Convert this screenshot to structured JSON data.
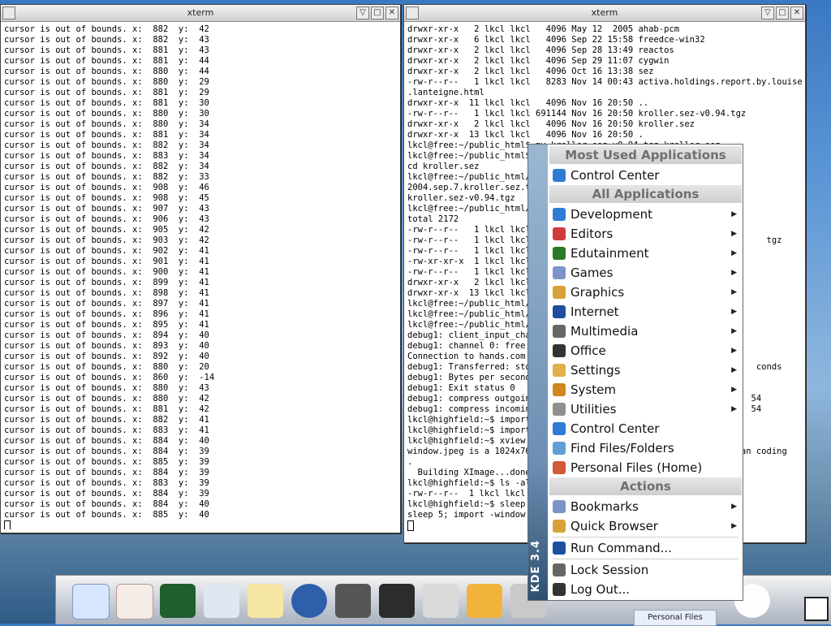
{
  "left_window": {
    "title": "xterm",
    "lines": [
      "cursor is out of bounds. x:  882  y:  42",
      "cursor is out of bounds. x:  882  y:  43",
      "cursor is out of bounds. x:  881  y:  43",
      "cursor is out of bounds. x:  881  y:  44",
      "cursor is out of bounds. x:  880  y:  44",
      "cursor is out of bounds. x:  880  y:  29",
      "cursor is out of bounds. x:  881  y:  29",
      "cursor is out of bounds. x:  881  y:  30",
      "cursor is out of bounds. x:  880  y:  30",
      "cursor is out of bounds. x:  880  y:  34",
      "cursor is out of bounds. x:  881  y:  34",
      "cursor is out of bounds. x:  882  y:  34",
      "cursor is out of bounds. x:  883  y:  34",
      "cursor is out of bounds. x:  882  y:  34",
      "cursor is out of bounds. x:  882  y:  33",
      "cursor is out of bounds. x:  908  y:  46",
      "cursor is out of bounds. x:  908  y:  45",
      "cursor is out of bounds. x:  907  y:  43",
      "cursor is out of bounds. x:  906  y:  43",
      "cursor is out of bounds. x:  905  y:  42",
      "cursor is out of bounds. x:  903  y:  42",
      "cursor is out of bounds. x:  902  y:  41",
      "cursor is out of bounds. x:  901  y:  41",
      "cursor is out of bounds. x:  900  y:  41",
      "cursor is out of bounds. x:  899  y:  41",
      "cursor is out of bounds. x:  898  y:  41",
      "cursor is out of bounds. x:  897  y:  41",
      "cursor is out of bounds. x:  896  y:  41",
      "cursor is out of bounds. x:  895  y:  41",
      "cursor is out of bounds. x:  894  y:  40",
      "cursor is out of bounds. x:  893  y:  40",
      "cursor is out of bounds. x:  892  y:  40",
      "cursor is out of bounds. x:  880  y:  20",
      "cursor is out of bounds. x:  860  y:  -14",
      "cursor is out of bounds. x:  880  y:  43",
      "cursor is out of bounds. x:  880  y:  42",
      "cursor is out of bounds. x:  881  y:  42",
      "cursor is out of bounds. x:  882  y:  41",
      "cursor is out of bounds. x:  883  y:  41",
      "cursor is out of bounds. x:  884  y:  40",
      "cursor is out of bounds. x:  884  y:  39",
      "cursor is out of bounds. x:  885  y:  39",
      "cursor is out of bounds. x:  884  y:  39",
      "cursor is out of bounds. x:  883  y:  39",
      "cursor is out of bounds. x:  884  y:  39",
      "cursor is out of bounds. x:  884  y:  40",
      "cursor is out of bounds. x:  885  y:  40"
    ]
  },
  "right_window": {
    "title": "xterm",
    "lines": [
      "drwxr-xr-x   2 lkcl lkcl   4096 May 12  2005 ahab-pcm",
      "drwxr-xr-x   6 lkcl lkcl   4096 Sep 22 15:58 freedce-win32",
      "drwxr-xr-x   2 lkcl lkcl   4096 Sep 28 13:49 reactos",
      "drwxr-xr-x   2 lkcl lkcl   4096 Sep 29 11:07 cygwin",
      "drwxr-xr-x   2 lkcl lkcl   4096 Oct 16 13:38 sez",
      "-rw-r--r--   1 lkcl lkcl   8283 Nov 14 00:43 activa.holdings.report.by.louisette",
      ".lanteigne.html",
      "drwxr-xr-x  11 lkcl lkcl   4096 Nov 16 20:50 ..",
      "-rw-r--r--   1 lkcl lkcl 691144 Nov 16 20:50 kroller.sez-v0.94.tgz",
      "drwxr-xr-x   2 lkcl lkcl   4096 Nov 16 20:50 kroller.sez",
      "drwxr-xr-x  13 lkcl lkcl   4096 Nov 16 20:50 .",
      "lkcl@free:~/public_html$ mv kroller.sez-v0.94.tgz kroller.sez",
      "lkcl@free:~/public_html$",
      "cd kroller.sez",
      "lkcl@free:~/public_html/k",
      "2004.sep.7.kroller.sez.tg",
      "kroller.sez-v0.94.tgz",
      "lkcl@free:~/public_html/k",
      "total 2172",
      "-rw-r--r--   1 lkcl lkcl",
      "-rw-r--r--   1 lkcl lkcl                                              tgz",
      "-rw-r--r--   1 lkcl lkcl",
      "-rw-xr-xr-x  1 lkcl lkcl",
      "-rw-r--r--   1 lkcl lkcl",
      "drwxr-xr-x   2 lkcl lkcl",
      "drwxr-xr-x  13 lkcl lkcl",
      "lkcl@free:~/public_html/k",
      "lkcl@free:~/public_html/k",
      "lkcl@free:~/public_html/k",
      "debug1: client_input_chan",
      "debug1: channel 0: free:",
      "Connection to hands.com c",
      "debug1: Transferred: std                                            conds",
      "debug1: Bytes per second",
      "debug1: Exit status 0",
      "debug1: compress outgoing                                          54",
      "debug1: compress incoming                                          54",
      "lkcl@highfield:~$ import",
      "",
      "lkcl@highfield:~$ import",
      "lkcl@highfield:~$ xview w",
      "window.jpeg is a 1024x768                                     ffman coding",
      ".",
      "  Building XImage...done",
      "lkcl@highfield:~$ ls -alt",
      "-rw-r--r--  1 lkcl lkcl 2",
      "lkcl@highfield:~$ sleep 5",
      "sleep 5; import -window r"
    ]
  },
  "kmenu": {
    "side_label": "KDE 3.4",
    "sections": {
      "most_used": "Most Used Applications",
      "all_apps": "All Applications",
      "actions": "Actions"
    },
    "most_used_items": [
      "Control Center"
    ],
    "all_apps_items": [
      {
        "label": "Development",
        "submenu": true
      },
      {
        "label": "Editors",
        "submenu": true
      },
      {
        "label": "Edutainment",
        "submenu": true
      },
      {
        "label": "Games",
        "submenu": true
      },
      {
        "label": "Graphics",
        "submenu": true
      },
      {
        "label": "Internet",
        "submenu": true
      },
      {
        "label": "Multimedia",
        "submenu": true
      },
      {
        "label": "Office",
        "submenu": true
      },
      {
        "label": "Settings",
        "submenu": true
      },
      {
        "label": "System",
        "submenu": true
      },
      {
        "label": "Utilities",
        "submenu": true
      },
      {
        "label": "Control Center",
        "submenu": false
      },
      {
        "label": "Find Files/Folders",
        "submenu": false
      },
      {
        "label": "Personal Files (Home)",
        "submenu": false
      }
    ],
    "action_items": [
      {
        "label": "Bookmarks",
        "submenu": true
      },
      {
        "label": "Quick Browser",
        "submenu": true
      },
      {
        "label": "Run Command...",
        "submenu": false
      },
      {
        "label": "Lock Session",
        "submenu": false
      },
      {
        "label": "Log Out...",
        "submenu": false
      }
    ]
  },
  "taskbar": {
    "task_button": "Personal Files"
  }
}
